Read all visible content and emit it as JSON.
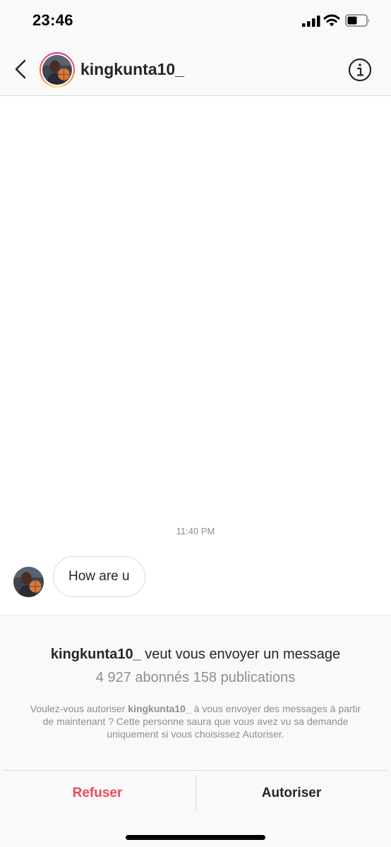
{
  "status_bar": {
    "time": "23:46",
    "icons": [
      "cellular-signal-icon",
      "wifi-icon",
      "battery-icon"
    ]
  },
  "header": {
    "back_icon": "chevron-left-icon",
    "username": "kingkunta10_",
    "info_icon": "info-icon"
  },
  "conversation": {
    "timestamp": "11:40 PM",
    "messages": [
      {
        "sender": "kingkunta10_",
        "text": "How are u"
      }
    ]
  },
  "request": {
    "title_user": "kingkunta10_",
    "title_rest": " veut vous envoyer un message",
    "stats": "4 927 abonnés 158 publications",
    "desc_before": "Voulez-vous autoriser ",
    "desc_user": "kingkunta10_",
    "desc_after": " à vous envoyer des messages à partir de maintenant ? Cette personne saura que vous avez vu sa demande uniquement si vous choisissez Autoriser.",
    "refuse_label": "Refuser",
    "allow_label": "Autoriser"
  },
  "colors": {
    "refuse": "#ed4956",
    "text_primary": "#262626",
    "text_secondary": "#8e8e8e",
    "border": "#dbdbdb",
    "panel_bg": "#f9f9f9"
  }
}
